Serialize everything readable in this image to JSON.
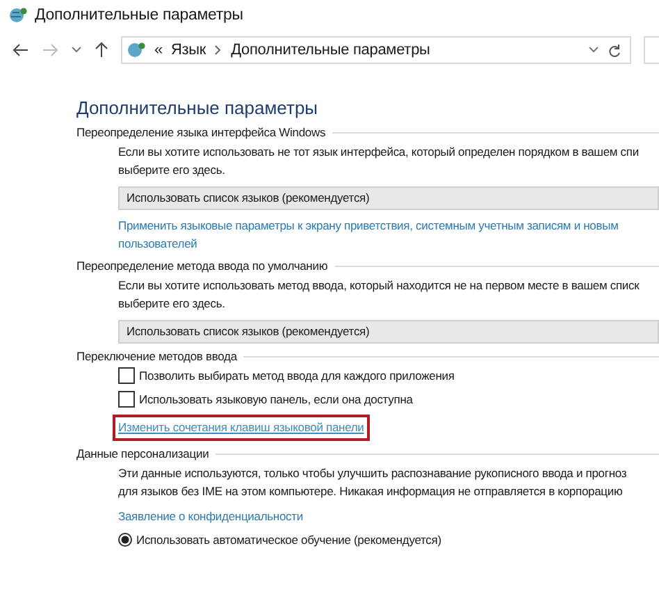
{
  "window": {
    "title": "Дополнительные параметры"
  },
  "address_bar": {
    "overflow": "«",
    "breadcrumb": [
      "Язык",
      "Дополнительные параметры"
    ]
  },
  "heading": "Дополнительные параметры",
  "sections": [
    {
      "title": "Переопределение языка интерфейса Windows",
      "items": [
        {
          "kind": "text",
          "text": "Если вы хотите использовать не тот язык интерфейса, который определен порядком в вашем спи\nвыберите его здесь."
        },
        {
          "kind": "dropdown",
          "text": "Использовать список языков (рекомендуется)"
        },
        {
          "kind": "link",
          "text": "Применить языковые параметры к экрану приветствия, системным учетным записям и новым\nпользователей",
          "highlighted": false
        }
      ]
    },
    {
      "title": "Переопределение метода ввода по умолчанию",
      "items": [
        {
          "kind": "text",
          "text": "Если вы хотите использовать метод ввода, который находится не на первом месте в вашем списк\nвыберите его здесь."
        },
        {
          "kind": "dropdown",
          "text": "Использовать список языков (рекомендуется)"
        }
      ]
    },
    {
      "title": "Переключение методов ввода",
      "items": [
        {
          "kind": "checkbox",
          "text": "Позволить выбирать метод ввода для каждого приложения",
          "checked": false
        },
        {
          "kind": "checkbox",
          "text": "Использовать языковую панель, если она доступна",
          "checked": false
        },
        {
          "kind": "link",
          "text": "Изменить сочетания клавиш языковой панели",
          "highlighted": true
        }
      ]
    },
    {
      "title": "Данные персонализации",
      "items": [
        {
          "kind": "text",
          "text": "Эти данные используются, только чтобы улучшить распознавание рукописного ввода и прогноз\nдля языков без IME на этом компьютере. Никакая информация не отправляется в корпорацию"
        },
        {
          "kind": "link",
          "text": "Заявление о конфиденциальности",
          "highlighted": false
        },
        {
          "kind": "radio",
          "text": "Использовать автоматическое обучение (рекомендуется)",
          "selected": true
        }
      ]
    }
  ]
}
